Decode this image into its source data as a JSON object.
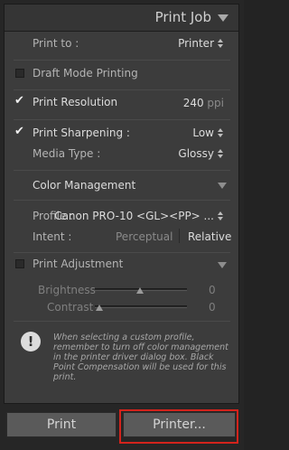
{
  "header": {
    "title": "Print Job"
  },
  "print_to": {
    "label": "Print to :",
    "value": "Printer"
  },
  "draft_mode": {
    "label": "Draft Mode Printing",
    "checked": false
  },
  "print_resolution": {
    "label": "Print Resolution",
    "checked": true,
    "value": "240",
    "unit": "ppi"
  },
  "print_sharpening": {
    "label": "Print Sharpening :",
    "checked": true,
    "value": "Low"
  },
  "media_type": {
    "label": "Media Type :",
    "value": "Glossy"
  },
  "color_management": {
    "title": "Color Management",
    "profile_label": "Profile :",
    "profile_value": "Canon PRO-10 <GL><PP> ...",
    "intent_label": "Intent :",
    "intent_options": [
      "Perceptual",
      "Relative"
    ],
    "intent_selected": "Relative"
  },
  "print_adjustment": {
    "label": "Print Adjustment",
    "checked": false,
    "brightness_label": "Brightness",
    "brightness_value": "0",
    "contrast_label": "Contrast",
    "contrast_value": "0"
  },
  "info": {
    "text": "When selecting a custom profile, remember to turn off color management in the printer driver dialog box. Black Point Compensation will be used for this print."
  },
  "buttons": {
    "print": "Print",
    "printer": "Printer..."
  },
  "colors": {
    "highlight": "#d3231c",
    "panel": "#3c3c3c"
  },
  "icons": [
    "collapse-triangle-icon",
    "updown-arrows-icon",
    "checkmark-icon",
    "exclamation-icon"
  ]
}
